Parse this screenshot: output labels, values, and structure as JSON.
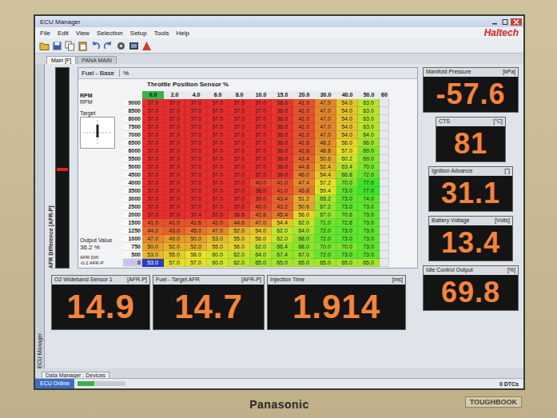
{
  "window": {
    "title": "ECU Manager"
  },
  "menu": [
    "File",
    "Edit",
    "View",
    "Selection",
    "Setup",
    "Tools",
    "Help"
  ],
  "logo": "Haltech",
  "tabs": [
    {
      "label": "Main [F]",
      "selected": true
    },
    {
      "label": "PANA MAIN",
      "selected": false
    }
  ],
  "side_tab": "ECU Manager",
  "afr_gauge": {
    "label": "AFR Difference [AFR-P]",
    "level": 0.5
  },
  "table_panel": {
    "title": "Fuel - Base",
    "unit": "%",
    "axis_title": "Throttle Position Sensor %",
    "row_axis": "RPM",
    "row_unit": "RPM",
    "target_label": "Target",
    "output_label": "Output Value",
    "output_value": "36.2 %",
    "afr_diff_label": "AFR Diff:",
    "afr_diff_value": "-0.2 AFR-P"
  },
  "table": {
    "columns": [
      {
        "label": "0.0",
        "selected": true
      },
      {
        "label": "2.0",
        "selected": false
      },
      {
        "label": "4.0",
        "selected": false
      },
      {
        "label": "6.0",
        "selected": false
      },
      {
        "label": "8.0",
        "selected": false
      },
      {
        "label": "10.0",
        "selected": false
      },
      {
        "label": "15.0",
        "selected": false
      },
      {
        "label": "20.0",
        "selected": false
      },
      {
        "label": "30.0",
        "selected": false
      },
      {
        "label": "40.0",
        "selected": false
      },
      {
        "label": "50.0",
        "selected": false
      },
      {
        "label": "60",
        "selected": false
      }
    ],
    "rows": [
      {
        "rpm": "9000",
        "selected": false,
        "cells": [
          "37.0",
          "37.0",
          "37.0",
          "37.0",
          "37.0",
          "37.0",
          "38.0",
          "41.0",
          "47.0",
          "54.0",
          "63.0"
        ]
      },
      {
        "rpm": "8500",
        "selected": false,
        "cells": [
          "37.0",
          "37.0",
          "37.0",
          "37.0",
          "37.0",
          "37.0",
          "38.0",
          "41.0",
          "47.0",
          "54.0",
          "63.0"
        ]
      },
      {
        "rpm": "8000",
        "selected": false,
        "cells": [
          "37.0",
          "37.0",
          "37.0",
          "37.0",
          "37.0",
          "37.0",
          "38.0",
          "41.0",
          "47.0",
          "54.0",
          "63.0"
        ]
      },
      {
        "rpm": "7500",
        "selected": false,
        "cells": [
          "37.0",
          "37.0",
          "37.0",
          "37.0",
          "37.0",
          "37.0",
          "38.0",
          "41.0",
          "47.0",
          "54.0",
          "63.0"
        ]
      },
      {
        "rpm": "7000",
        "selected": false,
        "cells": [
          "37.0",
          "37.0",
          "37.0",
          "37.0",
          "37.0",
          "37.0",
          "38.0",
          "41.0",
          "47.0",
          "54.0",
          "64.0"
        ]
      },
      {
        "rpm": "6500",
        "selected": false,
        "cells": [
          "37.0",
          "37.0",
          "37.0",
          "37.0",
          "37.0",
          "37.0",
          "38.0",
          "41.6",
          "48.2",
          "56.0",
          "66.0"
        ]
      },
      {
        "rpm": "6000",
        "selected": false,
        "cells": [
          "37.0",
          "37.0",
          "37.0",
          "37.0",
          "37.0",
          "37.0",
          "38.0",
          "41.6",
          "48.8",
          "57.0",
          "69.0"
        ]
      },
      {
        "rpm": "5500",
        "selected": false,
        "cells": [
          "37.0",
          "37.0",
          "37.0",
          "37.0",
          "37.0",
          "37.0",
          "38.0",
          "43.4",
          "50.6",
          "60.2",
          "69.0"
        ]
      },
      {
        "rpm": "5000",
        "selected": false,
        "cells": [
          "37.0",
          "37.0",
          "37.0",
          "37.0",
          "37.0",
          "37.0",
          "38.0",
          "44.8",
          "52.4",
          "63.4",
          "70.0"
        ]
      },
      {
        "rpm": "4500",
        "selected": false,
        "cells": [
          "37.0",
          "37.0",
          "37.0",
          "37.0",
          "37.0",
          "37.0",
          "38.0",
          "46.0",
          "54.4",
          "66.8",
          "72.0"
        ]
      },
      {
        "rpm": "4000",
        "selected": false,
        "cells": [
          "37.0",
          "37.0",
          "37.0",
          "37.0",
          "37.0",
          "40.0",
          "41.0",
          "47.4",
          "57.2",
          "70.0",
          "77.0"
        ]
      },
      {
        "rpm": "3500",
        "selected": false,
        "cells": [
          "37.0",
          "37.0",
          "37.0",
          "37.0",
          "37.0",
          "38.0",
          "41.0",
          "45.8",
          "59.4",
          "73.0",
          "77.0"
        ]
      },
      {
        "rpm": "3000",
        "selected": false,
        "cells": [
          "37.0",
          "37.0",
          "37.0",
          "37.0",
          "37.0",
          "39.0",
          "43.4",
          "51.2",
          "65.2",
          "73.0",
          "74.0"
        ]
      },
      {
        "rpm": "2500",
        "selected": false,
        "cells": [
          "37.0",
          "37.0",
          "37.0",
          "37.0",
          "37.0",
          "40.0",
          "43.2",
          "50.6",
          "67.2",
          "73.0",
          "73.0"
        ]
      },
      {
        "rpm": "2000",
        "selected": false,
        "cells": [
          "37.0",
          "37.0",
          "37.4",
          "37.0",
          "38.6",
          "42.8",
          "45.4",
          "56.0",
          "67.0",
          "70.6",
          "73.0"
        ]
      },
      {
        "rpm": "1500",
        "selected": false,
        "cells": [
          "41.0",
          "41.0",
          "41.6",
          "42.0",
          "44.6",
          "47.0",
          "54.4",
          "62.0",
          "71.0",
          "72.6",
          "73.0"
        ]
      },
      {
        "rpm": "1250",
        "selected": false,
        "cells": [
          "44.0",
          "43.0",
          "45.0",
          "47.0",
          "52.0",
          "54.0",
          "62.0",
          "64.0",
          "72.0",
          "73.0",
          "73.0"
        ]
      },
      {
        "rpm": "1000",
        "selected": false,
        "cells": [
          "47.0",
          "49.0",
          "50.0",
          "53.0",
          "55.0",
          "56.0",
          "62.0",
          "68.0",
          "72.0",
          "73.0",
          "73.0"
        ]
      },
      {
        "rpm": "750",
        "selected": false,
        "cells": [
          "50.0",
          "52.0",
          "52.0",
          "55.0",
          "56.0",
          "62.0",
          "66.4",
          "68.0",
          "70.0",
          "70.0",
          "73.0"
        ]
      },
      {
        "rpm": "500",
        "selected": false,
        "cells": [
          "53.0",
          "55.0",
          "58.0",
          "60.0",
          "62.0",
          "64.0",
          "67.4",
          "67.0",
          "72.0",
          "73.0",
          "73.0"
        ]
      },
      {
        "rpm": "0",
        "selected": true,
        "cells": [
          "53.0",
          "57.0",
          "57.0",
          "60.0",
          "62.0",
          "65.0",
          "65.0",
          "65.0",
          "65.0",
          "65.0",
          "65.0"
        ]
      }
    ]
  },
  "gauges_right": [
    {
      "label": "Manifold Pressure",
      "unit": "[kPa]",
      "value": "-57.6"
    },
    {
      "label": "CTS",
      "unit": "[°C]",
      "value": "81"
    },
    {
      "label": "Ignition Advance",
      "unit": "[°]",
      "value": "31.1"
    },
    {
      "label": "Battery Voltage",
      "unit": "[Volts]",
      "value": "13.4"
    },
    {
      "label": "Idle Control Output",
      "unit": "[%]",
      "value": "69.8"
    }
  ],
  "gauges_bottom": [
    {
      "label": "O2 Wideband Sensor 1",
      "unit": "[AFR-P]",
      "value": "14.9"
    },
    {
      "label": "Fuel - Target AFR",
      "unit": "[AFR-P]",
      "value": "14.7"
    },
    {
      "label": "Injection Time",
      "unit": "[ms]",
      "value": "1.914"
    }
  ],
  "bottom_tab": "Data Manager : Devices",
  "status_bar": {
    "online": "ECU Online",
    "level": 0.35,
    "dtcs": "0 DTCs"
  },
  "bezel": {
    "brand": "Panasonic",
    "model": "TOUGHBOOK"
  }
}
